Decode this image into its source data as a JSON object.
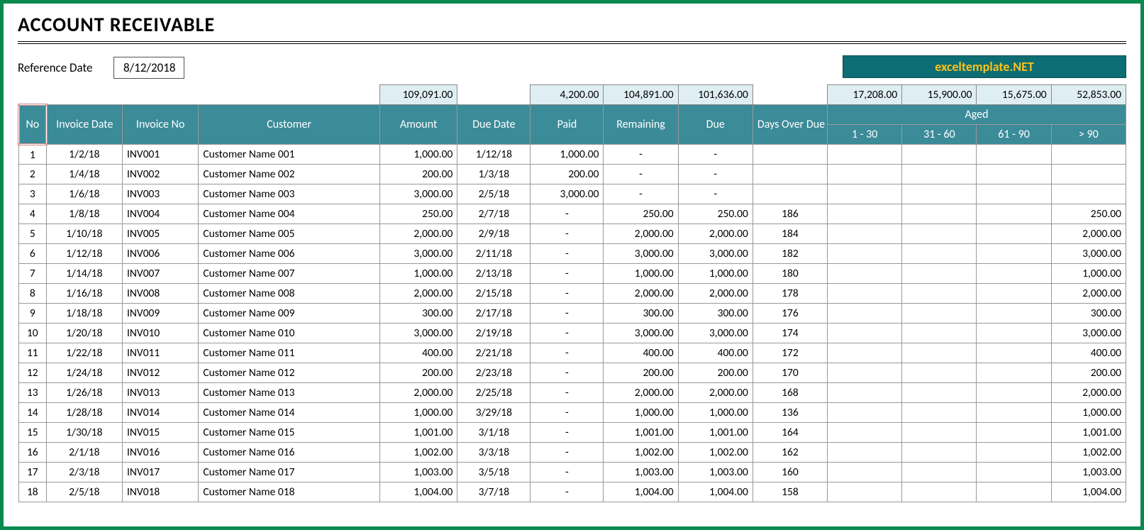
{
  "title": "ACCOUNT RECEIVABLE",
  "reference_label": "Reference Date",
  "reference_date": "8/12/2018",
  "brand": "exceltemplate.NET",
  "sums": {
    "amount": "109,091.00",
    "paid": "4,200.00",
    "remaining": "104,891.00",
    "due": "101,636.00",
    "age_1_30": "17,208.00",
    "age_31_60": "15,900.00",
    "age_61_90": "15,675.00",
    "age_over_90": "52,853.00"
  },
  "headers": {
    "no": "No",
    "invoice_date": "Invoice Date",
    "invoice_no": "Invoice No",
    "customer": "Customer",
    "amount": "Amount",
    "due_date": "Due Date",
    "paid": "Paid",
    "remaining": "Remaining",
    "due": "Due",
    "days_over_due": "Days Over Due",
    "aged": "Aged",
    "age_1_30": "1 - 30",
    "age_31_60": "31 - 60",
    "age_61_90": "61 - 90",
    "age_over_90": "> 90"
  },
  "chart_data": {
    "type": "table",
    "columns": [
      "No",
      "Invoice Date",
      "Invoice No",
      "Customer",
      "Amount",
      "Due Date",
      "Paid",
      "Remaining",
      "Due",
      "Days Over Due",
      "1 - 30",
      "31 - 60",
      "61 - 90",
      "> 90"
    ]
  },
  "rows": [
    {
      "no": "1",
      "inv_date": "1/2/18",
      "inv_no": "INV001",
      "customer": "Customer Name 001",
      "amount": "1,000.00",
      "due_date": "1/12/18",
      "paid": "1,000.00",
      "remaining": "-",
      "due": "-",
      "days": "",
      "a1": "",
      "a2": "",
      "a3": "",
      "a4": ""
    },
    {
      "no": "2",
      "inv_date": "1/4/18",
      "inv_no": "INV002",
      "customer": "Customer Name 002",
      "amount": "200.00",
      "due_date": "1/3/18",
      "paid": "200.00",
      "remaining": "-",
      "due": "-",
      "days": "",
      "a1": "",
      "a2": "",
      "a3": "",
      "a4": ""
    },
    {
      "no": "3",
      "inv_date": "1/6/18",
      "inv_no": "INV003",
      "customer": "Customer Name 003",
      "amount": "3,000.00",
      "due_date": "2/5/18",
      "paid": "3,000.00",
      "remaining": "-",
      "due": "-",
      "days": "",
      "a1": "",
      "a2": "",
      "a3": "",
      "a4": ""
    },
    {
      "no": "4",
      "inv_date": "1/8/18",
      "inv_no": "INV004",
      "customer": "Customer Name 004",
      "amount": "250.00",
      "due_date": "2/7/18",
      "paid": "-",
      "remaining": "250.00",
      "due": "250.00",
      "days": "186",
      "a1": "",
      "a2": "",
      "a3": "",
      "a4": "250.00"
    },
    {
      "no": "5",
      "inv_date": "1/10/18",
      "inv_no": "INV005",
      "customer": "Customer Name 005",
      "amount": "2,000.00",
      "due_date": "2/9/18",
      "paid": "-",
      "remaining": "2,000.00",
      "due": "2,000.00",
      "days": "184",
      "a1": "",
      "a2": "",
      "a3": "",
      "a4": "2,000.00"
    },
    {
      "no": "6",
      "inv_date": "1/12/18",
      "inv_no": "INV006",
      "customer": "Customer Name 006",
      "amount": "3,000.00",
      "due_date": "2/11/18",
      "paid": "-",
      "remaining": "3,000.00",
      "due": "3,000.00",
      "days": "182",
      "a1": "",
      "a2": "",
      "a3": "",
      "a4": "3,000.00"
    },
    {
      "no": "7",
      "inv_date": "1/14/18",
      "inv_no": "INV007",
      "customer": "Customer Name 007",
      "amount": "1,000.00",
      "due_date": "2/13/18",
      "paid": "-",
      "remaining": "1,000.00",
      "due": "1,000.00",
      "days": "180",
      "a1": "",
      "a2": "",
      "a3": "",
      "a4": "1,000.00"
    },
    {
      "no": "8",
      "inv_date": "1/16/18",
      "inv_no": "INV008",
      "customer": "Customer Name 008",
      "amount": "2,000.00",
      "due_date": "2/15/18",
      "paid": "-",
      "remaining": "2,000.00",
      "due": "2,000.00",
      "days": "178",
      "a1": "",
      "a2": "",
      "a3": "",
      "a4": "2,000.00"
    },
    {
      "no": "9",
      "inv_date": "1/18/18",
      "inv_no": "INV009",
      "customer": "Customer Name 009",
      "amount": "300.00",
      "due_date": "2/17/18",
      "paid": "-",
      "remaining": "300.00",
      "due": "300.00",
      "days": "176",
      "a1": "",
      "a2": "",
      "a3": "",
      "a4": "300.00"
    },
    {
      "no": "10",
      "inv_date": "1/20/18",
      "inv_no": "INV010",
      "customer": "Customer Name 010",
      "amount": "3,000.00",
      "due_date": "2/19/18",
      "paid": "-",
      "remaining": "3,000.00",
      "due": "3,000.00",
      "days": "174",
      "a1": "",
      "a2": "",
      "a3": "",
      "a4": "3,000.00"
    },
    {
      "no": "11",
      "inv_date": "1/22/18",
      "inv_no": "INV011",
      "customer": "Customer Name 011",
      "amount": "400.00",
      "due_date": "2/21/18",
      "paid": "-",
      "remaining": "400.00",
      "due": "400.00",
      "days": "172",
      "a1": "",
      "a2": "",
      "a3": "",
      "a4": "400.00"
    },
    {
      "no": "12",
      "inv_date": "1/24/18",
      "inv_no": "INV012",
      "customer": "Customer Name 012",
      "amount": "200.00",
      "due_date": "2/23/18",
      "paid": "-",
      "remaining": "200.00",
      "due": "200.00",
      "days": "170",
      "a1": "",
      "a2": "",
      "a3": "",
      "a4": "200.00"
    },
    {
      "no": "13",
      "inv_date": "1/26/18",
      "inv_no": "INV013",
      "customer": "Customer Name 013",
      "amount": "2,000.00",
      "due_date": "2/25/18",
      "paid": "-",
      "remaining": "2,000.00",
      "due": "2,000.00",
      "days": "168",
      "a1": "",
      "a2": "",
      "a3": "",
      "a4": "2,000.00"
    },
    {
      "no": "14",
      "inv_date": "1/28/18",
      "inv_no": "INV014",
      "customer": "Customer Name 014",
      "amount": "1,000.00",
      "due_date": "3/29/18",
      "paid": "-",
      "remaining": "1,000.00",
      "due": "1,000.00",
      "days": "136",
      "a1": "",
      "a2": "",
      "a3": "",
      "a4": "1,000.00"
    },
    {
      "no": "15",
      "inv_date": "1/30/18",
      "inv_no": "INV015",
      "customer": "Customer Name 015",
      "amount": "1,001.00",
      "due_date": "3/1/18",
      "paid": "-",
      "remaining": "1,001.00",
      "due": "1,001.00",
      "days": "164",
      "a1": "",
      "a2": "",
      "a3": "",
      "a4": "1,001.00"
    },
    {
      "no": "16",
      "inv_date": "2/1/18",
      "inv_no": "INV016",
      "customer": "Customer Name 016",
      "amount": "1,002.00",
      "due_date": "3/3/18",
      "paid": "-",
      "remaining": "1,002.00",
      "due": "1,002.00",
      "days": "162",
      "a1": "",
      "a2": "",
      "a3": "",
      "a4": "1,002.00"
    },
    {
      "no": "17",
      "inv_date": "2/3/18",
      "inv_no": "INV017",
      "customer": "Customer Name 017",
      "amount": "1,003.00",
      "due_date": "3/5/18",
      "paid": "-",
      "remaining": "1,003.00",
      "due": "1,003.00",
      "days": "160",
      "a1": "",
      "a2": "",
      "a3": "",
      "a4": "1,003.00"
    },
    {
      "no": "18",
      "inv_date": "2/5/18",
      "inv_no": "INV018",
      "customer": "Customer Name 018",
      "amount": "1,004.00",
      "due_date": "3/7/18",
      "paid": "-",
      "remaining": "1,004.00",
      "due": "1,004.00",
      "days": "158",
      "a1": "",
      "a2": "",
      "a3": "",
      "a4": "1,004.00"
    }
  ]
}
